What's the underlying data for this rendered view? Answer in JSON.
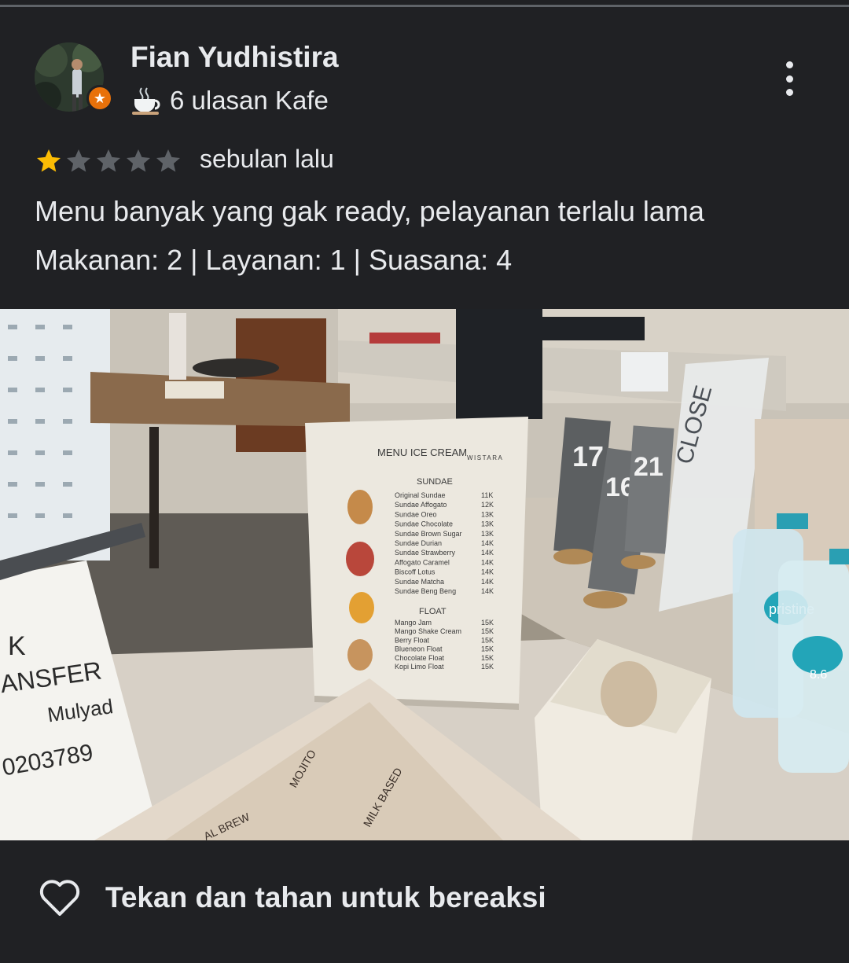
{
  "reviewer": {
    "name": "Fian Yudhistira",
    "reviews_label": "6 ulasan Kafe",
    "badge_icon": "star-badge-icon",
    "cup_icon": "coffee-cup-icon"
  },
  "rating": {
    "stars": 1,
    "max": 5,
    "filled_color": "#fbbc04",
    "empty_color": "#5f6368"
  },
  "date": "sebulan lalu",
  "review_text": "Menu banyak yang gak ready, pelayanan terlalu lama",
  "sub_ratings": "Makanan: 2 | Layanan: 1 | Suasana: 4",
  "photo": {
    "menu_header": "MENU ICE CREAM",
    "brand": "WISTARA",
    "section_sundae": "SUNDAE",
    "sundae_items": [
      {
        "name": "Original Sundae",
        "price": "11K"
      },
      {
        "name": "Sundae Affogato",
        "price": "12K"
      },
      {
        "name": "Sundae Oreo",
        "price": "13K"
      },
      {
        "name": "Sundae Chocolate",
        "price": "13K"
      },
      {
        "name": "Sundae Brown Sugar",
        "price": "13K"
      },
      {
        "name": "Sundae Durian",
        "price": "14K"
      },
      {
        "name": "Sundae Strawberry",
        "price": "14K"
      },
      {
        "name": "Affogato Caramel",
        "price": "14K"
      },
      {
        "name": "Biscoff Lotus",
        "price": "14K"
      },
      {
        "name": "Sundae Matcha",
        "price": "14K"
      },
      {
        "name": "Sundae Beng Beng",
        "price": "14K"
      }
    ],
    "section_float": "FLOAT",
    "float_items": [
      {
        "name": "Mango Jam",
        "price": "15K"
      },
      {
        "name": "Mango Shake Cream",
        "price": "15K"
      },
      {
        "name": "Berry Float",
        "price": "15K"
      },
      {
        "name": "Blueneon Float",
        "price": "15K"
      },
      {
        "name": "Chocolate Float",
        "price": "15K"
      },
      {
        "name": "Kopi Limo Float",
        "price": "15K"
      }
    ],
    "table_numbers": [
      "17",
      "16",
      "21"
    ],
    "close_sign": "CLOSE",
    "note_lines": [
      "K",
      "ANSFER",
      "Mulyad",
      "0203789"
    ],
    "bottle_label": "pristine",
    "bottle_sub": "8.6",
    "lower_menu_sections": [
      "MOJITO",
      "MILK BASED",
      "AL BREW"
    ]
  },
  "reaction": {
    "label": "Tekan dan tahan untuk bereaksi"
  }
}
